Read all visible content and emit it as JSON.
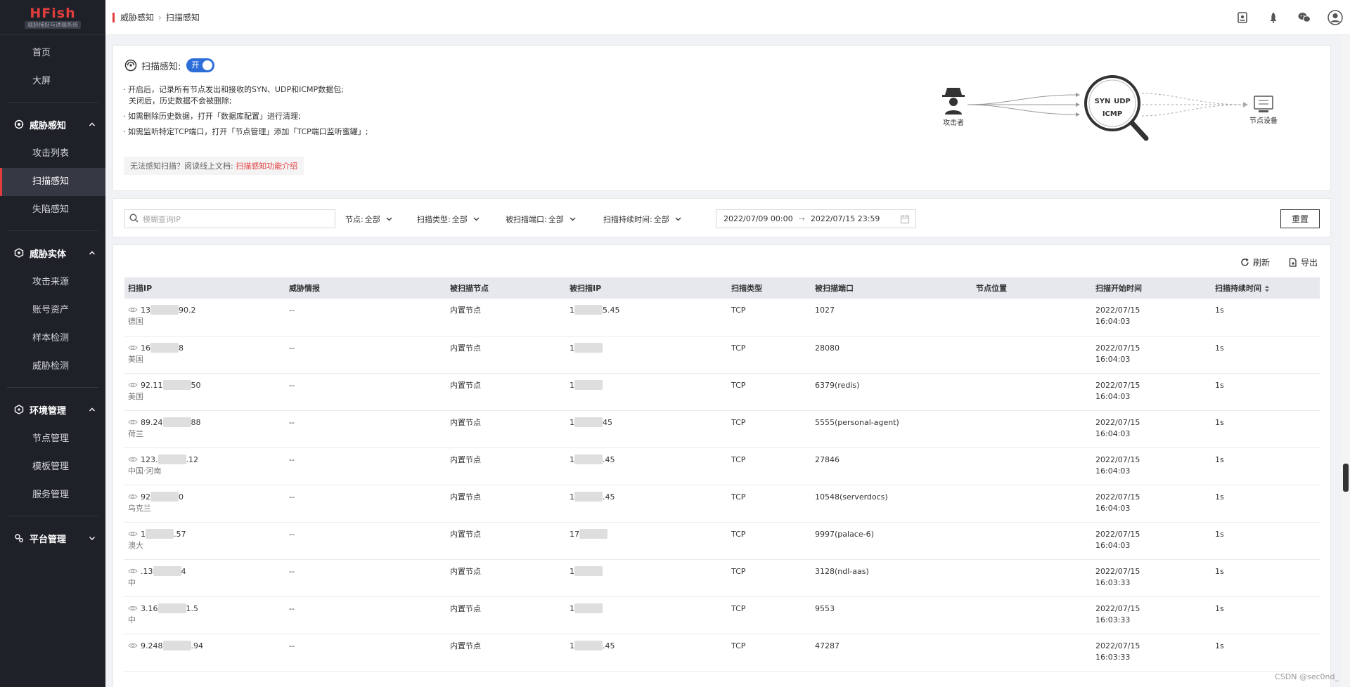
{
  "brand": {
    "name": "HFish",
    "subtitle": "威胁捕捉与诱骗系统"
  },
  "sidebar": {
    "top_items": [
      {
        "label": "首页"
      },
      {
        "label": "大屏"
      }
    ],
    "groups": [
      {
        "label": "威胁感知",
        "items": [
          {
            "label": "攻击列表"
          },
          {
            "label": "扫描感知"
          },
          {
            "label": "失陷感知"
          }
        ]
      },
      {
        "label": "威胁实体",
        "items": [
          {
            "label": "攻击来源"
          },
          {
            "label": "账号资产"
          },
          {
            "label": "样本检测"
          },
          {
            "label": "威胁检测"
          }
        ]
      },
      {
        "label": "环境管理",
        "items": [
          {
            "label": "节点管理"
          },
          {
            "label": "模板管理"
          },
          {
            "label": "服务管理"
          }
        ]
      },
      {
        "label": "平台管理",
        "items": []
      }
    ]
  },
  "header": {
    "breadcrumb": [
      "威胁感知",
      "扫描感知"
    ]
  },
  "scan": {
    "switch_label": "扫描感知:",
    "toggle_text": "开",
    "bullet1_line1": "开启后，记录所有节点发出和接收的SYN、UDP和ICMP数据包;",
    "bullet1_line2": "关闭后，历史数据不会被删除;",
    "bullet2": "如需删除历史数据，打开「数据库配置」进行清理;",
    "bullet3": "如需监听特定TCP端口，打开「节点管理」添加「TCP端口监听蜜罐」;",
    "tip_text": "无法感知扫描？阅读线上文档:",
    "tip_link": "扫描感知功能介绍",
    "diagram": {
      "attacker": "攻击者",
      "node": "节点设备",
      "syn": "SYN",
      "udp": "UDP",
      "icmp": "ICMP"
    }
  },
  "filters": {
    "search_placeholder": "模糊查询IP",
    "node_label": "节点:",
    "node_value": "全部",
    "type_label": "扫描类型:",
    "type_value": "全部",
    "port_label": "被扫描端口:",
    "port_value": "全部",
    "duration_label": "扫描持续时间:",
    "duration_value": "全部",
    "date_start": "2022/07/09 00:00",
    "date_arrow": "→",
    "date_end": "2022/07/15 23:59",
    "reset": "重置"
  },
  "tools": {
    "refresh": "刷新",
    "export": "导出"
  },
  "table": {
    "columns": [
      "扫描IP",
      "威胁情报",
      "被扫描节点",
      "被扫描IP",
      "扫描类型",
      "被扫描端口",
      "节点位置",
      "扫描开始时间",
      "扫描持续时间"
    ],
    "rows": [
      {
        "ip": "13",
        "ip2": "90.2",
        "loc": "德国",
        "intel": "--",
        "node": "内置节点",
        "tip": "1",
        "tip2": "5.45",
        "type": "TCP",
        "port": "1027",
        "nodeloc": "",
        "date": "2022/07/15",
        "time": "16:04:03",
        "dur": "1s"
      },
      {
        "ip": "16",
        "ip2": "8",
        "loc": "美国",
        "intel": "--",
        "node": "内置节点",
        "tip": "1",
        "tip2": "",
        "type": "TCP",
        "port": "28080",
        "nodeloc": "",
        "date": "2022/07/15",
        "time": "16:04:03",
        "dur": "1s"
      },
      {
        "ip": "92.11",
        "ip2": "50",
        "loc": "美国",
        "intel": "--",
        "node": "内置节点",
        "tip": "1",
        "tip2": "",
        "type": "TCP",
        "port": "6379(redis)",
        "nodeloc": "",
        "date": "2022/07/15",
        "time": "16:04:03",
        "dur": "1s"
      },
      {
        "ip": "89.24",
        "ip2": "88",
        "loc": "荷兰",
        "intel": "--",
        "node": "内置节点",
        "tip": "1",
        "tip2": "45",
        "type": "TCP",
        "port": "5555(personal-agent)",
        "nodeloc": "",
        "date": "2022/07/15",
        "time": "16:04:03",
        "dur": "1s"
      },
      {
        "ip": "123.",
        "ip2": ".12",
        "loc": "中国·河南",
        "intel": "--",
        "node": "内置节点",
        "tip": "1",
        "tip2": ".45",
        "type": "TCP",
        "port": "27846",
        "nodeloc": "",
        "date": "2022/07/15",
        "time": "16:04:03",
        "dur": "1s"
      },
      {
        "ip": "92",
        "ip2": "0",
        "loc": "乌克兰",
        "intel": "--",
        "node": "内置节点",
        "tip": "1",
        "tip2": ".45",
        "type": "TCP",
        "port": "10548(serverdocs)",
        "nodeloc": "",
        "date": "2022/07/15",
        "time": "16:04:03",
        "dur": "1s"
      },
      {
        "ip": "1",
        "ip2": ".57",
        "loc": "澳大",
        "intel": "--",
        "node": "内置节点",
        "tip": "17",
        "tip2": "",
        "type": "TCP",
        "port": "9997(palace-6)",
        "nodeloc": "",
        "date": "2022/07/15",
        "time": "16:04:03",
        "dur": "1s"
      },
      {
        "ip": ".13",
        "ip2": "4",
        "loc": "中",
        "intel": "--",
        "node": "内置节点",
        "tip": "1",
        "tip2": "",
        "type": "TCP",
        "port": "3128(ndl-aas)",
        "nodeloc": "",
        "date": "2022/07/15",
        "time": "16:03:33",
        "dur": "1s"
      },
      {
        "ip": "3.16",
        "ip2": "1.5",
        "loc": "中",
        "intel": "--",
        "node": "内置节点",
        "tip": "1",
        "tip2": "",
        "type": "TCP",
        "port": "9553",
        "nodeloc": "",
        "date": "2022/07/15",
        "time": "16:03:33",
        "dur": "1s"
      },
      {
        "ip": "9.248",
        "ip2": ".94",
        "loc": "",
        "intel": "--",
        "node": "内置节点",
        "tip": "1",
        "tip2": ".45",
        "type": "TCP",
        "port": "47287",
        "nodeloc": "",
        "date": "2022/07/15",
        "time": "16:03:33",
        "dur": "1s"
      }
    ]
  },
  "watermark": "CSDN @sec0nd_",
  "colors": {
    "accent": "#e23d3d",
    "toggle": "#2d6ed8",
    "sidebar_bg": "#1f2129"
  }
}
